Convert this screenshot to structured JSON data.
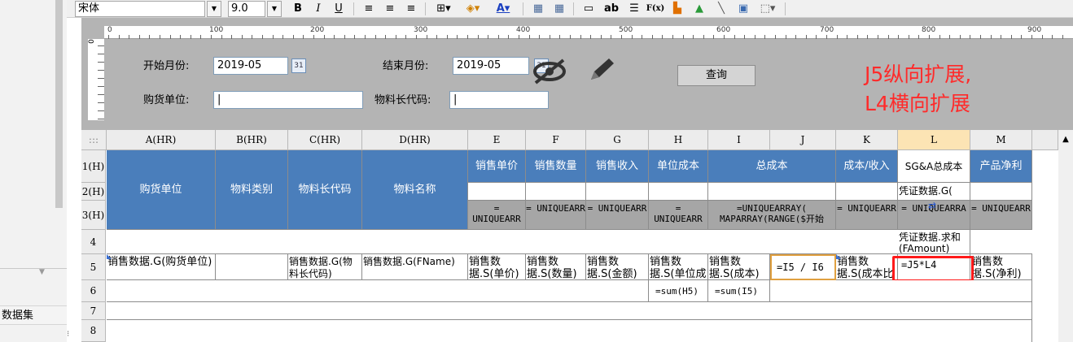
{
  "toolbar": {
    "font_name": "宋体",
    "font_size": "9.0",
    "bold_label": "B",
    "italic_label": "I",
    "underline_label": "U",
    "text_tool_label": "ab",
    "function_label": "F(x)"
  },
  "ruler": {
    "marks": [
      "0",
      "100",
      "200",
      "300",
      "400",
      "500",
      "600",
      "700",
      "800",
      "900"
    ]
  },
  "form": {
    "start_month_label": "开始月份:",
    "start_month_value": "2019-05",
    "end_month_label": "结束月份:",
    "end_month_value": "2019-05",
    "supplier_label": "购货单位:",
    "material_code_label": "物料长代码:",
    "calendar_label": "31",
    "query_label": "查询"
  },
  "annotation": {
    "line1": "J5纵向扩展,",
    "line2": "L4横向扩展"
  },
  "sidebar": {
    "dataset_label": "数据集"
  },
  "grid": {
    "corner": ":::",
    "columns": [
      "A(HR)",
      "B(HR)",
      "C(HR)",
      "D(HR)",
      "E",
      "F",
      "G",
      "H",
      "I",
      "J",
      "K",
      "L",
      "M"
    ],
    "rows": [
      "1(H)",
      "2(H)",
      "3(H)",
      "4",
      "5",
      "6",
      "7",
      "8"
    ],
    "header_merged": {
      "A": "购货单位",
      "B": "物料类别",
      "C": "物料长代码",
      "D": "物料名称"
    },
    "row1": {
      "E": "销售单价",
      "F": "销售数量",
      "G": "销售收入",
      "H": "单位成本",
      "IJ": "总成本",
      "K": "成本/收入",
      "L": "SG&A总成本",
      "M": "产品净利"
    },
    "row2": {
      "L": "凭证数据.G("
    },
    "row3": {
      "E": "= UNIQUEARR",
      "F": "= UNIQUEARR",
      "G": "= UNIQUEARR",
      "H": "= UNIQUEARR",
      "IJ": "=UNIQUEARRAY( MAPARRAY(RANGE($开始",
      "K": "= UNIQUEARR",
      "L": "= UNIQUEARRA",
      "M": "= UNIQUEARR"
    },
    "row4": {
      "L": "凭证数据.求和(FAmount)"
    },
    "row5": {
      "A": "销售数据.G(购货单位)",
      "C": "销售数据.G(物料长代码)",
      "D": "销售数据.G(FName)",
      "E": "销售数据.S(单价)",
      "F": "销售数据.S(数量)",
      "G": "销售数据.S(金额)",
      "H": "销售数据.S(单位成",
      "I": "销售数据.S(成本)",
      "J": "=I5 / I6",
      "K": "销售数据.S(成本比",
      "L": "=J5*L4",
      "M": "销售数据.S(净利)"
    },
    "row6": {
      "H": "=sum(H5)",
      "I": "=sum(I5)"
    }
  }
}
